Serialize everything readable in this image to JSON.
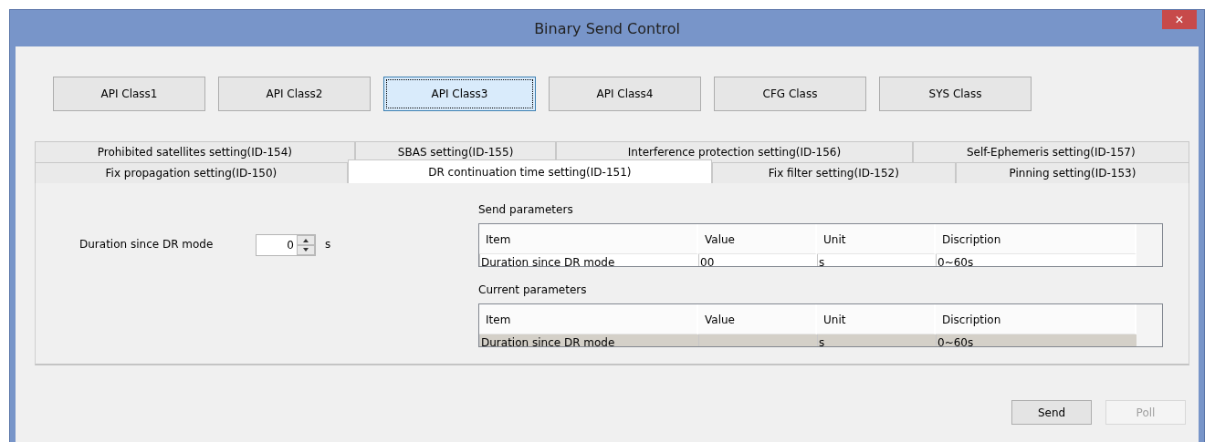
{
  "window": {
    "title": "Binary Send Control",
    "close": "×"
  },
  "class_buttons": [
    {
      "label": "API Class1",
      "selected": false
    },
    {
      "label": "API Class2",
      "selected": false
    },
    {
      "label": "API Class3",
      "selected": true
    },
    {
      "label": "API Class4",
      "selected": false
    },
    {
      "label": "CFG Class",
      "selected": false
    },
    {
      "label": "SYS Class",
      "selected": false
    }
  ],
  "tab_rows": [
    [
      {
        "label": "Prohibited satellites setting(ID-154)",
        "selected": false
      },
      {
        "label": "SBAS setting(ID-155)",
        "selected": false
      },
      {
        "label": "Interference protection setting(ID-156)",
        "selected": false
      },
      {
        "label": "Self-Ephemeris setting(ID-157)",
        "selected": false
      }
    ],
    [
      {
        "label": "Fix propagation setting(ID-150)",
        "selected": false
      },
      {
        "label": "DR continuation time setting(ID-151)",
        "selected": true
      },
      {
        "label": "Fix filter setting(ID-152)",
        "selected": false
      },
      {
        "label": "Pinning setting(ID-153)",
        "selected": false
      }
    ]
  ],
  "field": {
    "label": "Duration since DR mode",
    "value": "0",
    "unit": "s"
  },
  "tables": [
    {
      "title": "Send parameters",
      "columns": [
        "Item",
        "Value",
        "Unit",
        "Discription"
      ],
      "rows": [
        {
          "cells": [
            "Duration since DR mode",
            "00",
            "s",
            "0~60s"
          ],
          "selected": false
        }
      ]
    },
    {
      "title": "Current parameters",
      "columns": [
        "Item",
        "Value",
        "Unit",
        "Discription"
      ],
      "rows": [
        {
          "cells": [
            "Duration since DR mode",
            "",
            "s",
            "0~60s"
          ],
          "selected": true
        }
      ]
    }
  ],
  "buttons": [
    {
      "label": "Send",
      "disabled": false
    },
    {
      "label": "Poll",
      "disabled": true
    }
  ]
}
